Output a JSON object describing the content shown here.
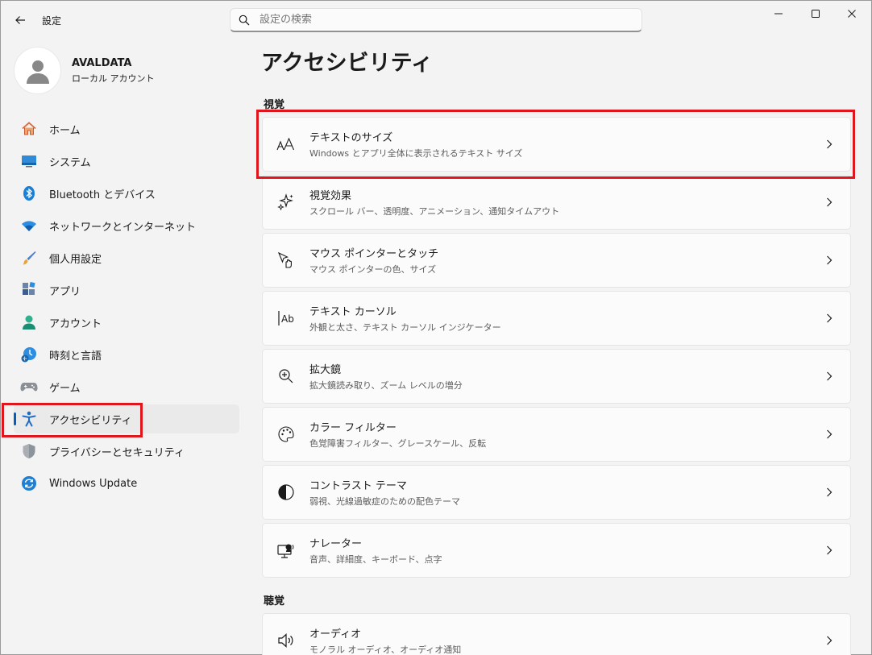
{
  "app": {
    "title": "設定",
    "search_placeholder": "設定の検索"
  },
  "profile": {
    "name": "AVALDATA",
    "account_type": "ローカル アカウント"
  },
  "sidebar": {
    "items": [
      {
        "label": "ホーム",
        "icon": "home-icon"
      },
      {
        "label": "システム",
        "icon": "system-icon"
      },
      {
        "label": "Bluetooth とデバイス",
        "icon": "bluetooth-icon"
      },
      {
        "label": "ネットワークとインターネット",
        "icon": "wifi-icon"
      },
      {
        "label": "個人用設定",
        "icon": "brush-icon"
      },
      {
        "label": "アプリ",
        "icon": "apps-icon"
      },
      {
        "label": "アカウント",
        "icon": "account-icon"
      },
      {
        "label": "時刻と言語",
        "icon": "time-language-icon"
      },
      {
        "label": "ゲーム",
        "icon": "gamepad-icon"
      },
      {
        "label": "アクセシビリティ",
        "icon": "accessibility-icon",
        "active": true
      },
      {
        "label": "プライバシーとセキュリティ",
        "icon": "shield-icon"
      },
      {
        "label": "Windows Update",
        "icon": "update-icon"
      }
    ]
  },
  "main": {
    "page_title": "アクセシビリティ",
    "sections": [
      {
        "title": "視覚",
        "items": [
          {
            "title": "テキストのサイズ",
            "subtitle": "Windows とアプリ全体に表示されるテキスト サイズ",
            "icon": "text-size-icon"
          },
          {
            "title": "視覚効果",
            "subtitle": "スクロール バー、透明度、アニメーション、通知タイムアウト",
            "icon": "visual-effects-icon"
          },
          {
            "title": "マウス ポインターとタッチ",
            "subtitle": "マウス ポインターの色、サイズ",
            "icon": "mouse-pointer-icon"
          },
          {
            "title": "テキスト カーソル",
            "subtitle": "外観と太さ、テキスト カーソル インジケーター",
            "icon": "text-cursor-icon"
          },
          {
            "title": "拡大鏡",
            "subtitle": "拡大鏡読み取り、ズーム レベルの増分",
            "icon": "magnifier-icon"
          },
          {
            "title": "カラー フィルター",
            "subtitle": "色覚障害フィルター、グレースケール、反転",
            "icon": "palette-icon"
          },
          {
            "title": "コントラスト テーマ",
            "subtitle": "弱視、光線過敏症のための配色テーマ",
            "icon": "contrast-icon"
          },
          {
            "title": "ナレーター",
            "subtitle": "音声、詳細度、キーボード、点字",
            "icon": "narrator-icon"
          }
        ]
      },
      {
        "title": "聴覚",
        "items": [
          {
            "title": "オーディオ",
            "subtitle": "モノラル オーディオ、オーディオ通知",
            "icon": "speaker-icon"
          }
        ]
      }
    ]
  },
  "colors": {
    "accent": "#005fb8",
    "highlight_box": "#e0161e"
  }
}
